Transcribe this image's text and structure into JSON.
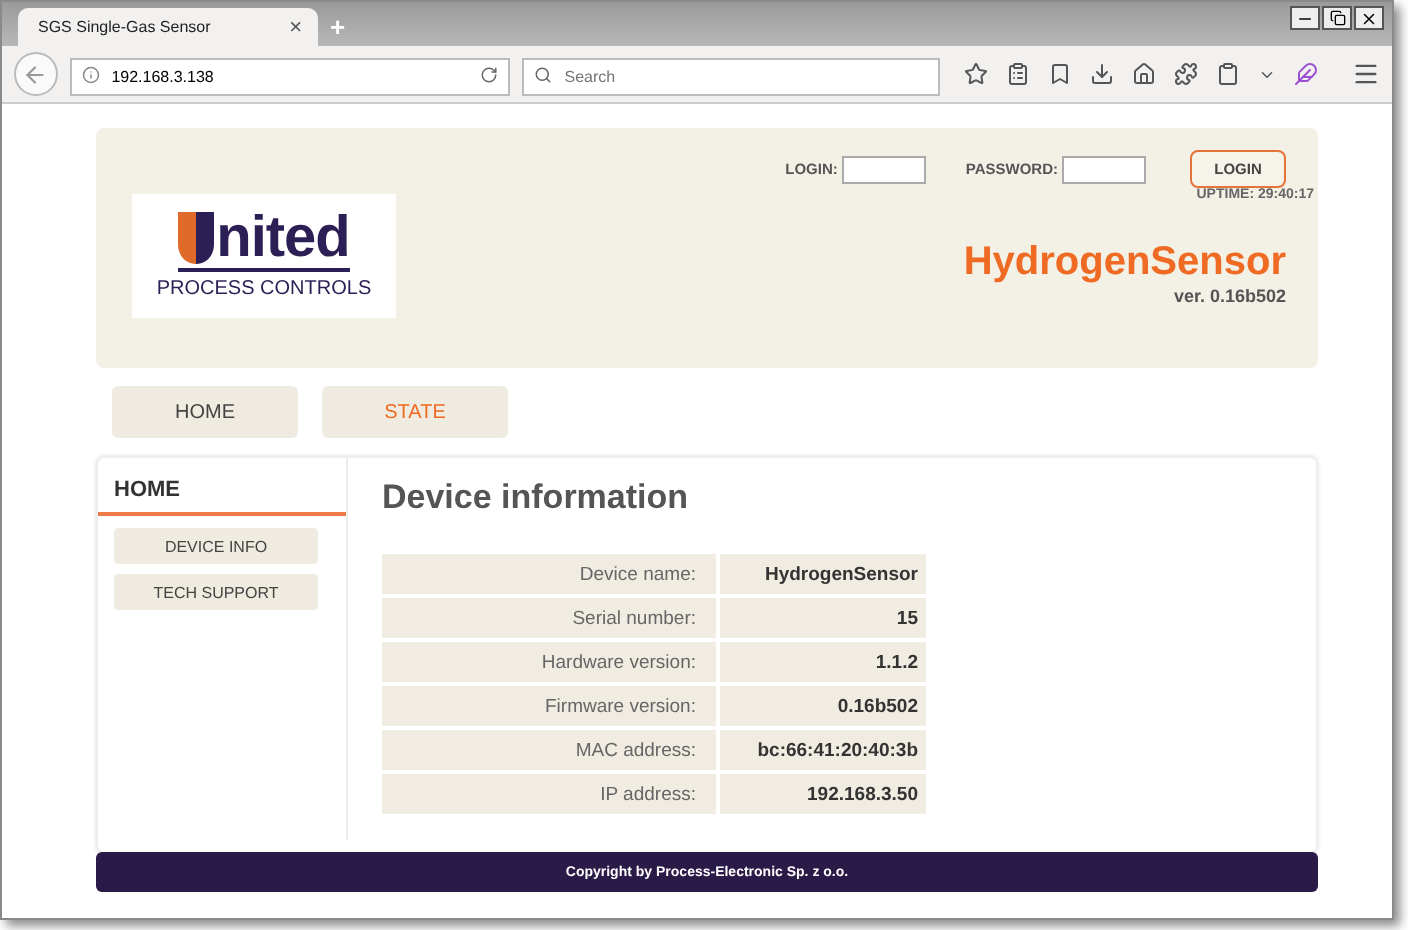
{
  "browser": {
    "tab_title": "SGS Single-Gas Sensor",
    "tab_close": "×",
    "new_tab": "+",
    "address": "192.168.3.138",
    "search_placeholder": "Search"
  },
  "header": {
    "login_label": "LOGIN:",
    "password_label": "PASSWORD:",
    "login_button": "LOGIN",
    "uptime": "UPTIME: 29:40:17",
    "logo_word": "nited",
    "logo_tagline": "PROCESS CONTROLS",
    "product": "HydrogenSensor",
    "version": "ver. 0.16b502"
  },
  "nav": [
    {
      "label": "HOME",
      "selected": false
    },
    {
      "label": "STATE",
      "selected": true
    }
  ],
  "sidebar": {
    "title": "HOME",
    "items": [
      "DEVICE INFO",
      "TECH SUPPORT"
    ]
  },
  "content": {
    "title": "Device information",
    "rows": [
      {
        "label": "Device name:",
        "value": "HydrogenSensor"
      },
      {
        "label": "Serial number:",
        "value": "15"
      },
      {
        "label": "Hardware version:",
        "value": "1.1.2"
      },
      {
        "label": "Firmware version:",
        "value": "0.16b502"
      },
      {
        "label": "MAC address:",
        "value": "bc:66:41:20:40:3b"
      },
      {
        "label": "IP address:",
        "value": "192.168.3.50"
      }
    ]
  },
  "footer": "Copyright by Process-Electronic Sp. z o.o."
}
